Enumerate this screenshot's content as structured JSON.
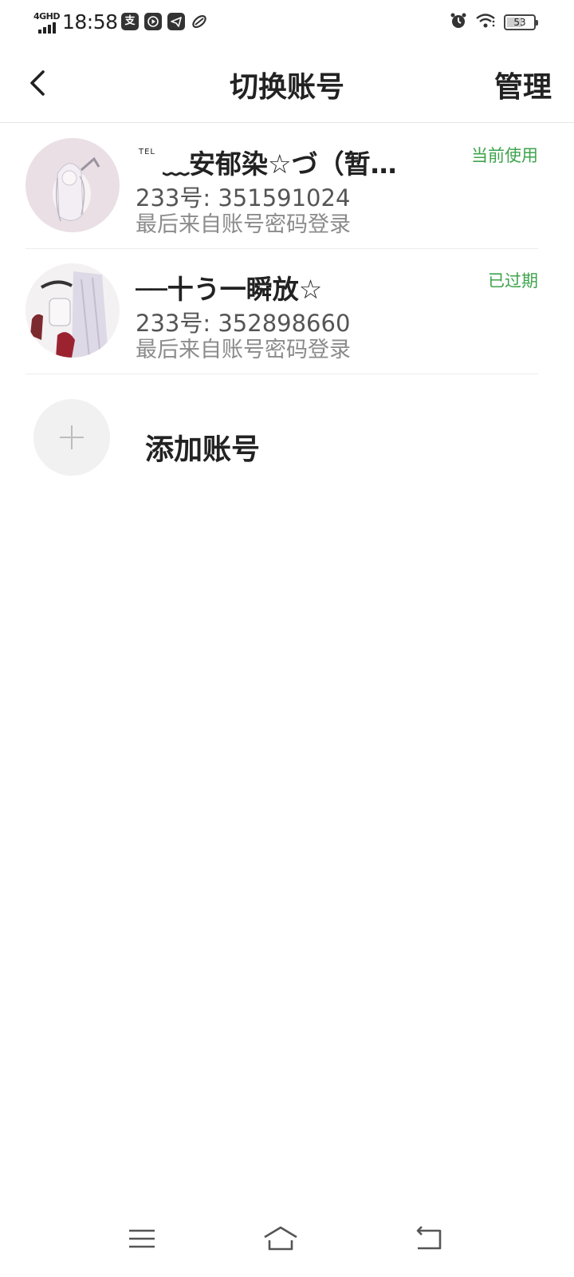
{
  "status_bar": {
    "network": "4GHD",
    "time": "18:58",
    "app_icons": [
      "alipay-icon",
      "video-play-icon",
      "telegram-icon",
      "sync-icon"
    ],
    "battery_level": "53",
    "alarm": true,
    "wifi": true
  },
  "header": {
    "title": "切换账号",
    "manage_label": "管理"
  },
  "accounts": [
    {
      "tel_label": "TEL",
      "name": "﹏安郁染☆づ（暂…",
      "id_text": "233号: 351591024",
      "login_text": "最后来自账号密码登录",
      "status": "当前使用"
    },
    {
      "name": "──十う一瞬放☆",
      "id_text": "233号: 352898660",
      "login_text": "最后来自账号密码登录",
      "status": "已过期"
    }
  ],
  "add_account": {
    "label": "添加账号"
  },
  "colors": {
    "status_green": "#3fa34d",
    "divider": "#ececec",
    "add_circle_bg": "#f1f1f1"
  },
  "nav_bar": {
    "icons": [
      "menu-icon",
      "home-icon",
      "back-nav-icon"
    ]
  }
}
